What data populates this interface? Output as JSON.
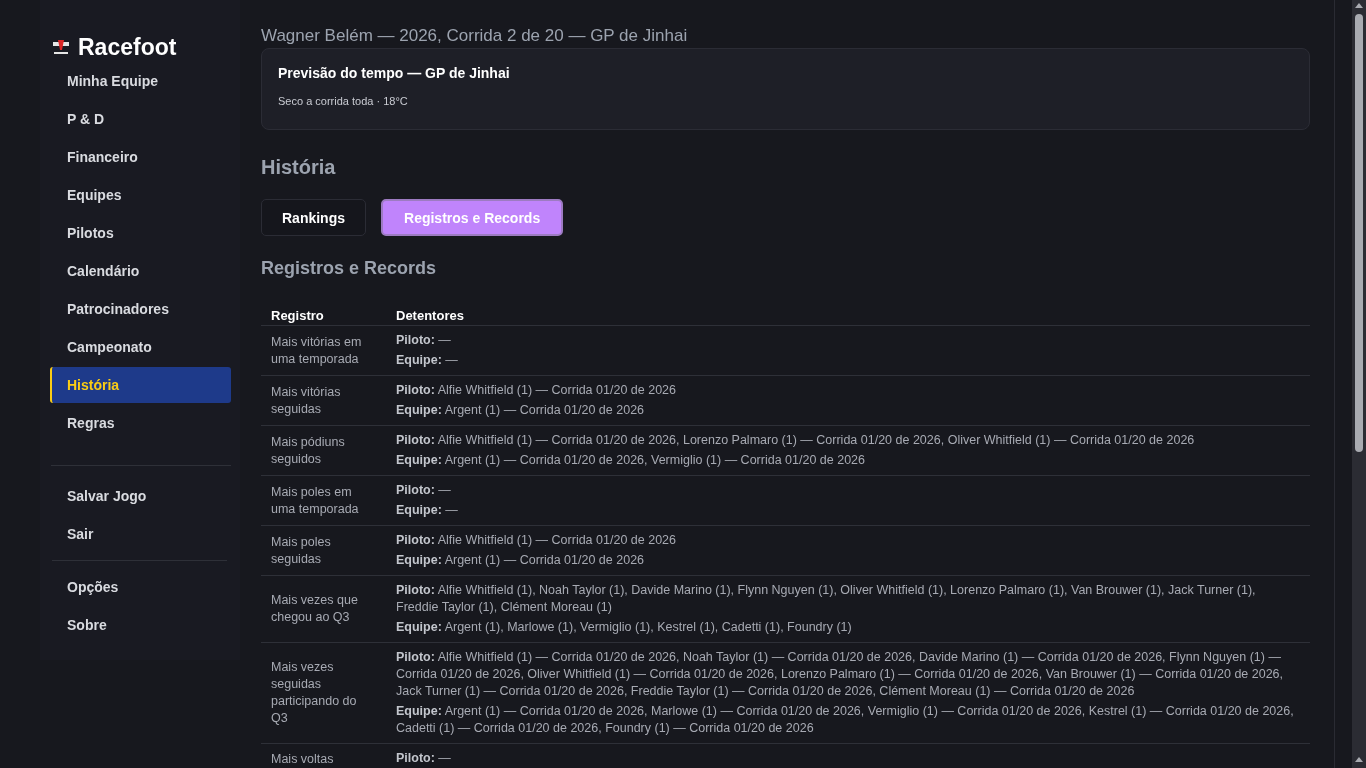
{
  "sidebar": {
    "logo": "Racefoot",
    "nav": [
      {
        "label": "Minha Equipe",
        "selected": false
      },
      {
        "label": "P & D",
        "selected": false
      },
      {
        "label": "Financeiro",
        "selected": false
      },
      {
        "label": "Equipes",
        "selected": false
      },
      {
        "label": "Pilotos",
        "selected": false
      },
      {
        "label": "Calendário",
        "selected": false
      },
      {
        "label": "Patrocinadores",
        "selected": false
      },
      {
        "label": "Campeonato",
        "selected": false
      },
      {
        "label": "História",
        "selected": true
      },
      {
        "label": "Regras",
        "selected": false
      }
    ],
    "actions": [
      "Salvar Jogo",
      "Sair"
    ],
    "footer": [
      "Opções",
      "Sobre"
    ]
  },
  "header": "Wagner Belém — 2026, Corrida 2 de 20 — GP de Jinhai",
  "weather": {
    "title": "Previsão do tempo — GP de Jinhai",
    "text": "Seco a corrida toda · 18°C"
  },
  "page_title": "História",
  "tabs": [
    {
      "label": "Rankings",
      "selected": false
    },
    {
      "label": "Registros e Records",
      "selected": true
    }
  ],
  "section_title": "Registros e Records",
  "table": {
    "columns": [
      "Registro",
      "Detentores"
    ],
    "rows": [
      {
        "record": "Mais vitórias em uma temporada",
        "holders": [
          "**Piloto:** —",
          "**Equipe:** —"
        ]
      },
      {
        "record": "Mais vitórias seguidas",
        "holders": [
          "**Piloto:** Alfie Whitfield (1) — Corrida 01/20 de 2026",
          "**Equipe:** Argent (1) — Corrida 01/20 de 2026"
        ]
      },
      {
        "record": "Mais pódiuns seguidos",
        "holders": [
          "**Piloto:** Alfie Whitfield (1) — Corrida 01/20 de 2026, Lorenzo Palmaro (1) — Corrida 01/20 de 2026, Oliver Whitfield (1) — Corrida 01/20 de 2026",
          "**Equipe:** Argent (1) — Corrida 01/20 de 2026, Vermiglio (1) — Corrida 01/20 de 2026"
        ]
      },
      {
        "record": "Mais poles em uma temporada",
        "holders": [
          "**Piloto:** —",
          "**Equipe:** —"
        ]
      },
      {
        "record": "Mais poles seguidas",
        "holders": [
          "**Piloto:** Alfie Whitfield (1) — Corrida 01/20 de 2026",
          "**Equipe:** Argent (1) — Corrida 01/20 de 2026"
        ]
      },
      {
        "record": "Mais vezes que chegou ao Q3",
        "holders": [
          "**Piloto:** Alfie Whitfield (1), Noah Taylor (1), Davide Marino (1), Flynn Nguyen (1), Oliver Whitfield (1), Lorenzo Palmaro (1), Van Brouwer (1), Jack Turner (1), Freddie Taylor (1), Clément Moreau (1)",
          "**Equipe:** Argent (1), Marlowe (1), Vermiglio (1), Kestrel (1), Cadetti (1), Foundry (1)"
        ]
      },
      {
        "record": "Mais vezes seguidas participando do Q3",
        "holders": [
          "**Piloto:** Alfie Whitfield (1) — Corrida 01/20 de 2026, Noah Taylor (1) — Corrida 01/20 de 2026, Davide Marino (1) — Corrida 01/20 de 2026, Flynn Nguyen (1) — Corrida 01/20 de 2026, Oliver Whitfield (1) — Corrida 01/20 de 2026, Lorenzo Palmaro (1) — Corrida 01/20 de 2026, Van Brouwer (1) — Corrida 01/20 de 2026, Jack Turner (1) — Corrida 01/20 de 2026, Freddie Taylor (1) — Corrida 01/20 de 2026, Clément Moreau (1) — Corrida 01/20 de 2026",
          "**Equipe:** Argent (1) — Corrida 01/20 de 2026, Marlowe (1) — Corrida 01/20 de 2026, Vermiglio (1) — Corrida 01/20 de 2026, Kestrel (1) — Corrida 01/20 de 2026, Cadetti (1) — Corrida 01/20 de 2026, Foundry (1) — Corrida 01/20 de 2026"
        ]
      },
      {
        "record": "Mais voltas",
        "holders": [
          "**Piloto:** —"
        ]
      }
    ]
  }
}
